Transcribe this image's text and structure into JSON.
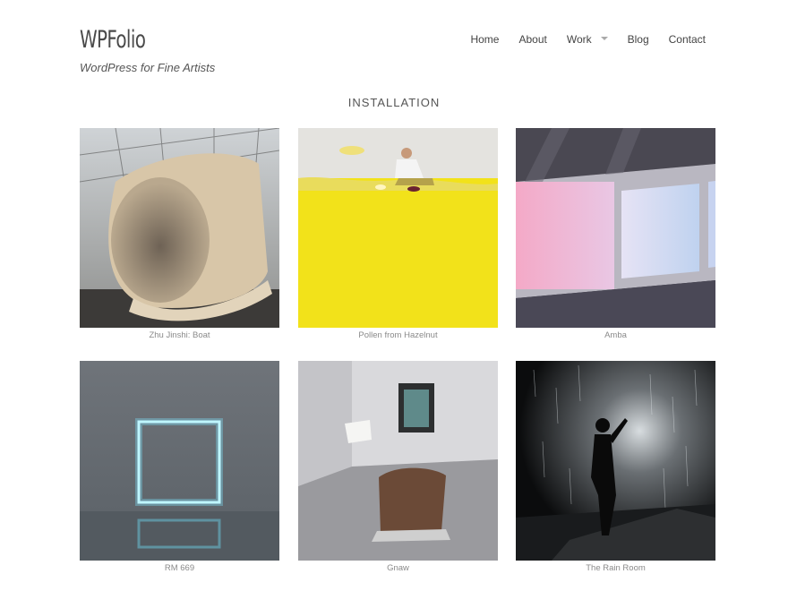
{
  "header": {
    "site_title": "WPFolio",
    "tagline": "WordPress for Fine Artists"
  },
  "nav": {
    "items": [
      {
        "label": "Home"
      },
      {
        "label": "About"
      },
      {
        "label": "Work",
        "has_dropdown": true
      },
      {
        "label": "Blog"
      },
      {
        "label": "Contact"
      }
    ]
  },
  "page": {
    "title": "INSTALLATION"
  },
  "gallery": [
    {
      "caption": "Zhu Jinshi: Boat"
    },
    {
      "caption": "Pollen from Hazelnut"
    },
    {
      "caption": "Amba"
    },
    {
      "caption": "RM 669"
    },
    {
      "caption": "Gnaw"
    },
    {
      "caption": "The Rain Room"
    }
  ]
}
